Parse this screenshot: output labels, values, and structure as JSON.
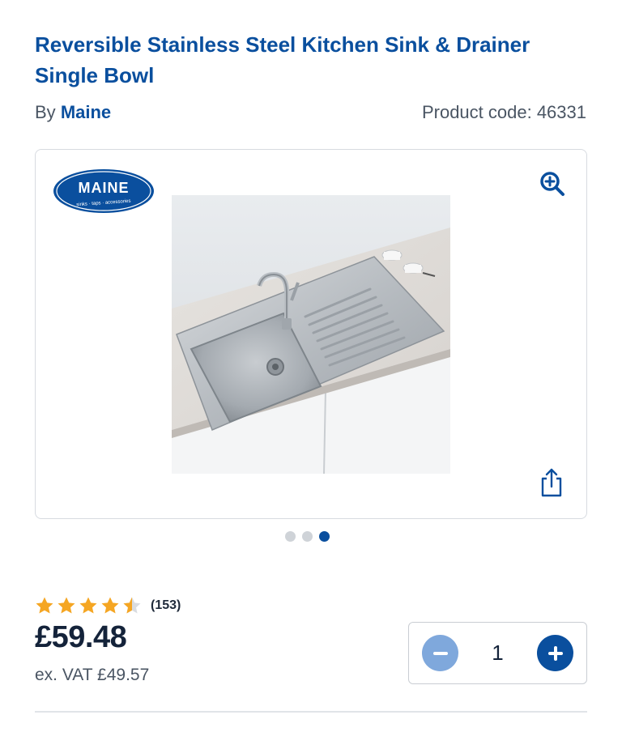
{
  "product": {
    "title": "Reversible Stainless Steel Kitchen Sink & Drainer Single Bowl",
    "by_label": "By",
    "brand": "Maine",
    "product_code": "Product code: 46331"
  },
  "gallery": {
    "logo_icon": "maine-logo",
    "logo_text": "MAINE",
    "logo_tagline": "sinks · taps · accessories",
    "zoom_icon": "zoom-in-icon",
    "share_icon": "share-icon",
    "image_alt": "stainless steel single bowl kitchen sink with drainer",
    "dots": [
      {
        "active": false
      },
      {
        "active": false
      },
      {
        "active": true
      }
    ]
  },
  "rating": {
    "stars": 4.5,
    "count": "(153)",
    "star_color": "#f5a623"
  },
  "pricing": {
    "price": "£59.48",
    "ex_vat": "ex. VAT £49.57"
  },
  "quantity": {
    "value": "1",
    "minus_icon": "minus-icon",
    "plus_icon": "plus-icon"
  },
  "colors": {
    "brand_blue": "#0a4f9e",
    "minus_disabled": "#7fa8dc"
  }
}
